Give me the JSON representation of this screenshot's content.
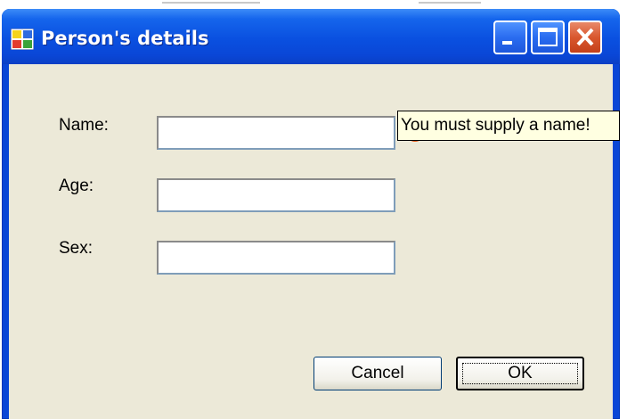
{
  "window": {
    "title": "Person's details"
  },
  "titlebar_buttons": {
    "minimize": "minimize-icon",
    "maximize": "maximize-icon",
    "close": "close-icon"
  },
  "form": {
    "name_label": "Name:",
    "age_label": "Age:",
    "sex_label": "Sex:",
    "name_value": "",
    "age_value": "",
    "sex_value": ""
  },
  "validation": {
    "icon": "error-icon",
    "tooltip": "You must supply a name!"
  },
  "buttons": {
    "cancel_label": "Cancel",
    "ok_label": "OK"
  },
  "colors": {
    "titlebar": "#0a46d6",
    "client": "#ece9d8",
    "close_button": "#d9572e",
    "error_icon": "#e85a17",
    "tooltip_bg": "#ffffe1"
  }
}
